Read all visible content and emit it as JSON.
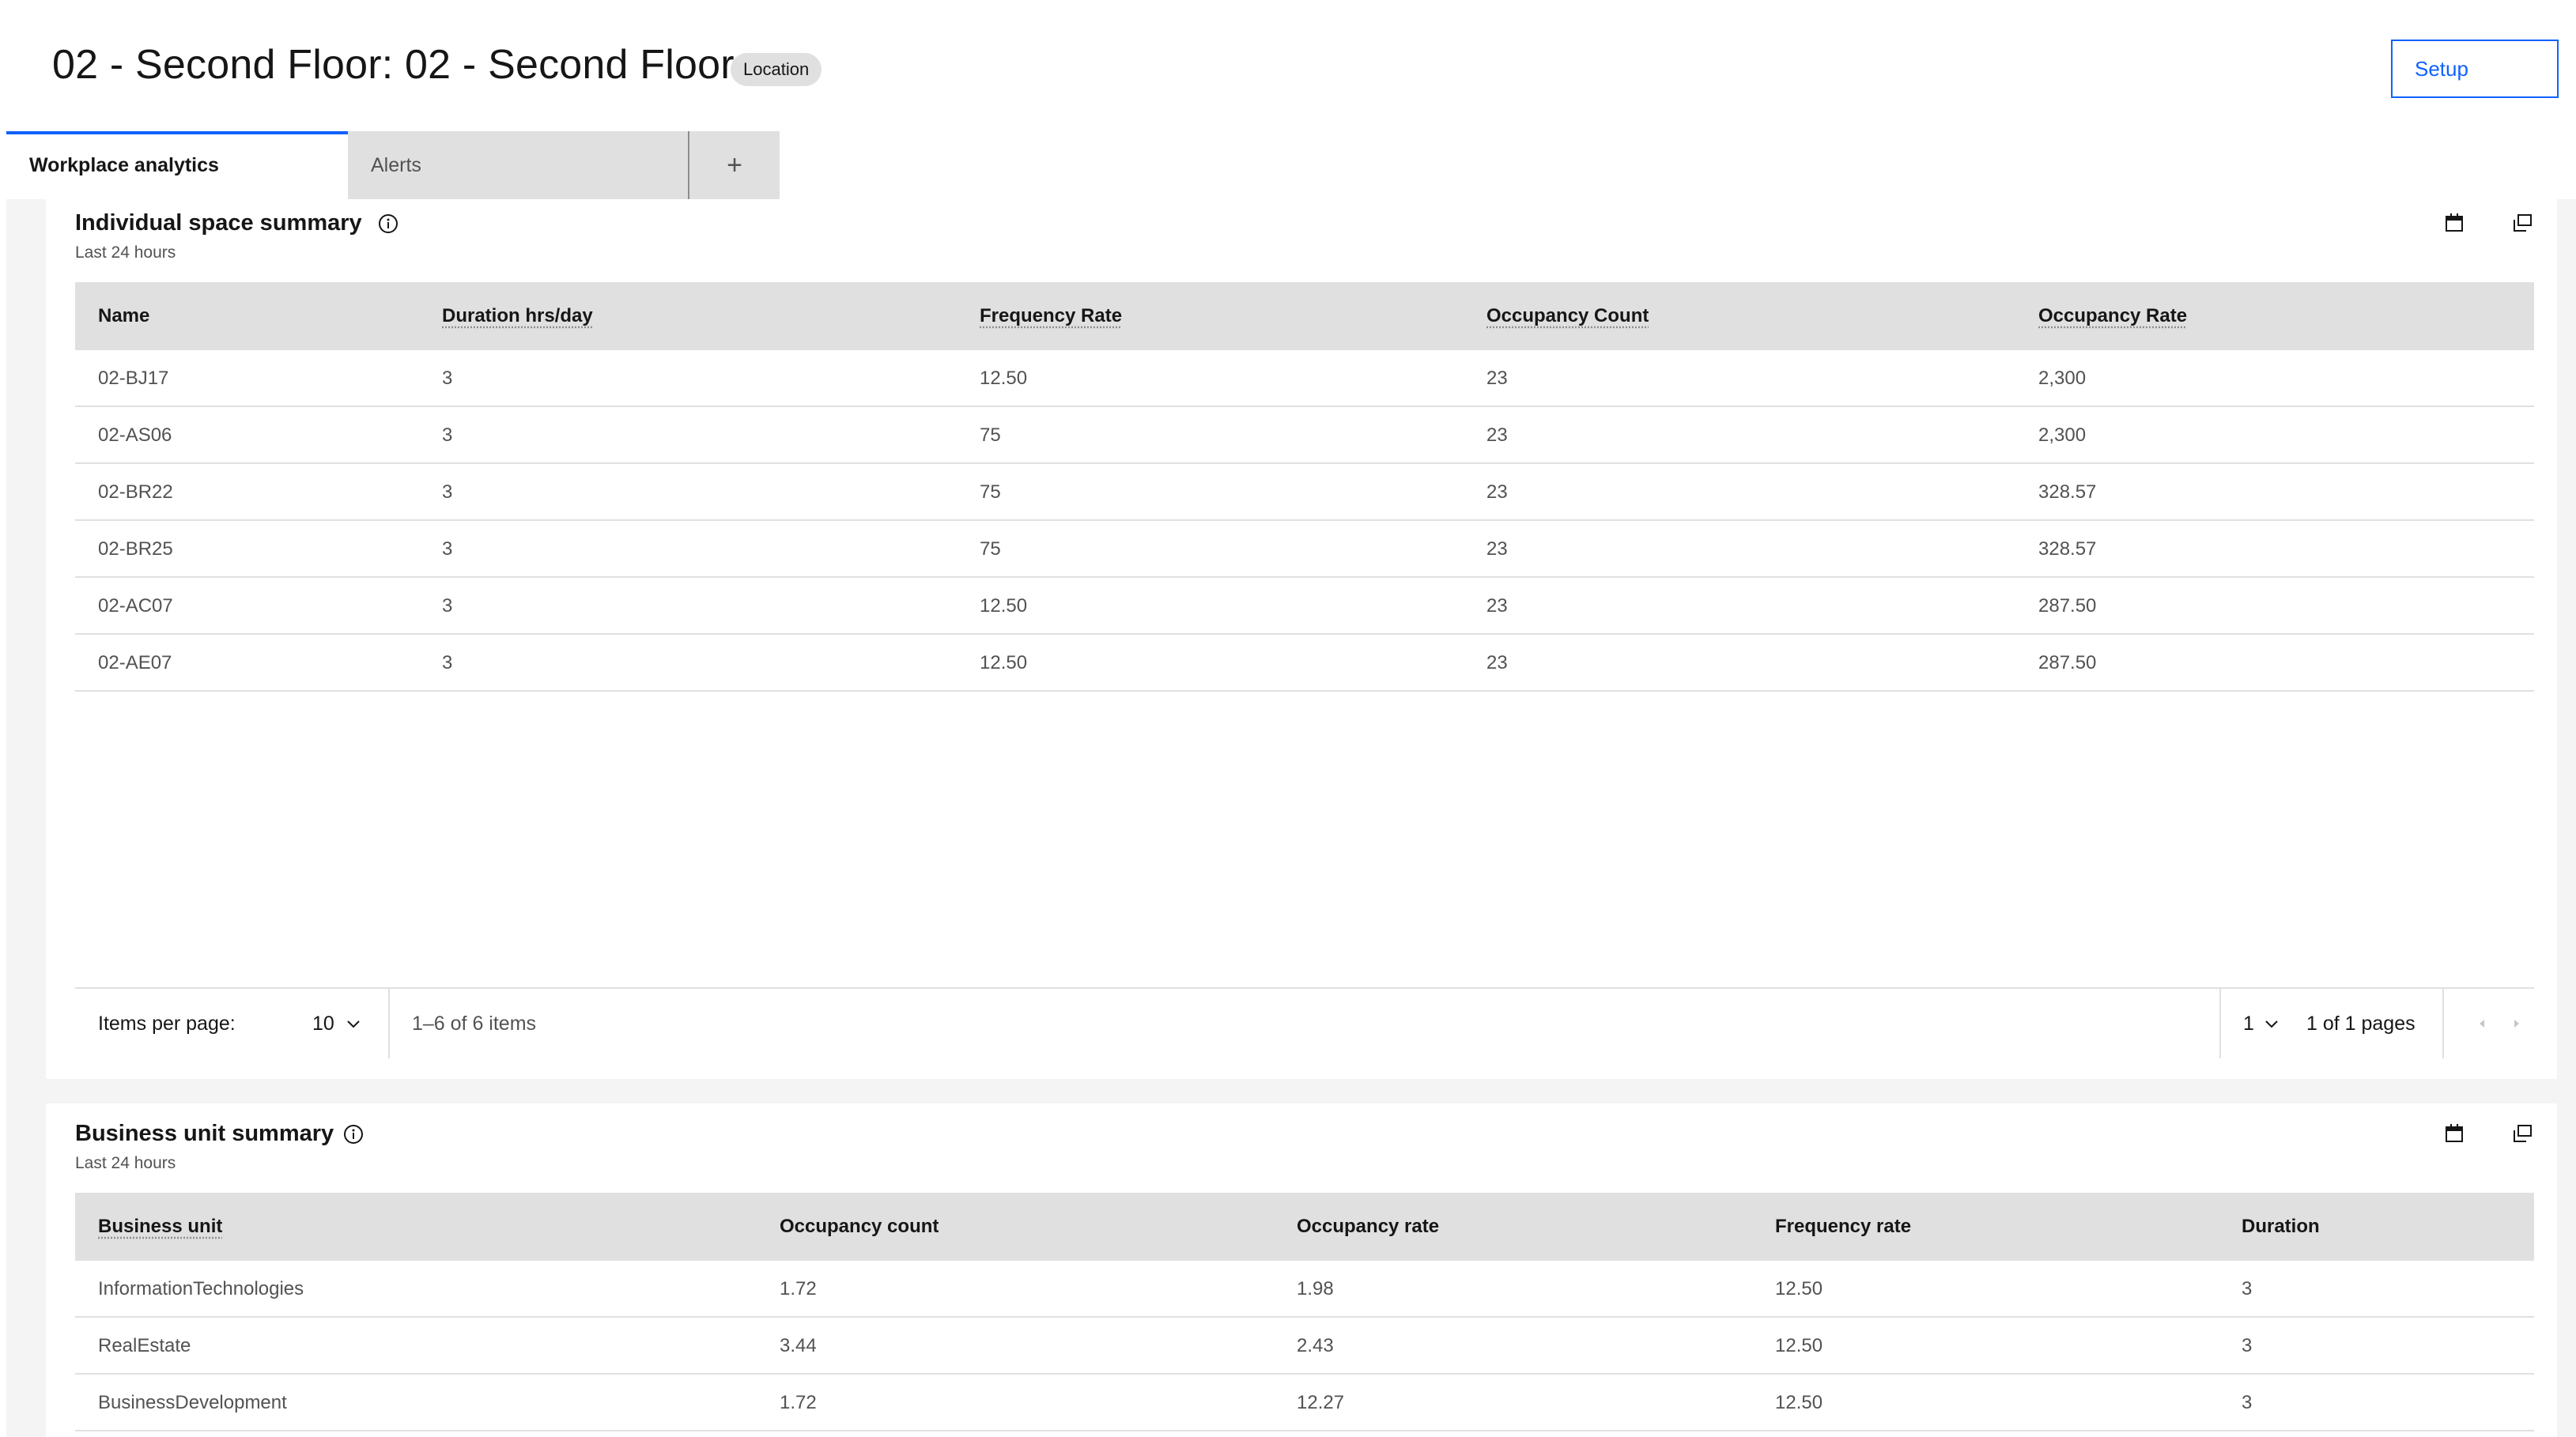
{
  "header": {
    "title": "02 - Second Floor: 02 - Second Floor",
    "tag": "Location",
    "setup_label": "Setup"
  },
  "tabs": [
    {
      "label": "Workplace analytics",
      "active": true
    },
    {
      "label": "Alerts",
      "active": false
    },
    {
      "label": "+",
      "active": false
    }
  ],
  "space_summary": {
    "title": "Individual space summary",
    "subtitle": "Last 24 hours",
    "icons": [
      "info-icon",
      "calendar-icon",
      "expand-icon"
    ],
    "columns": [
      "Name",
      "Duration hrs/day",
      "Frequency Rate",
      "Occupancy Count",
      "Occupancy Rate"
    ],
    "rows": [
      [
        "02-BJ17",
        "3",
        "12.50",
        "23",
        "2,300"
      ],
      [
        "02-AS06",
        "3",
        "75",
        "23",
        "2,300"
      ],
      [
        "02-BR22",
        "3",
        "75",
        "23",
        "328.57"
      ],
      [
        "02-BR25",
        "3",
        "75",
        "23",
        "328.57"
      ],
      [
        "02-AC07",
        "3",
        "12.50",
        "23",
        "287.50"
      ],
      [
        "02-AE07",
        "3",
        "12.50",
        "23",
        "287.50"
      ]
    ],
    "pagination": {
      "items_per_page_label": "Items per page:",
      "items_per_page": "10",
      "range": "1–6 of 6 items",
      "page": "1",
      "page_of": "1 of 1 pages"
    }
  },
  "business_summary": {
    "title": "Business unit summary",
    "subtitle": "Last 24 hours",
    "icons": [
      "info-icon",
      "calendar-icon",
      "expand-icon"
    ],
    "columns": [
      "Business unit",
      "Occupancy count",
      "Occupancy rate",
      "Frequency rate",
      "Duration"
    ],
    "rows": [
      [
        "InformationTechnologies",
        "1.72",
        "1.98",
        "12.50",
        "3"
      ],
      [
        "RealEstate",
        "3.44",
        "2.43",
        "12.50",
        "3"
      ],
      [
        "BusinessDevelopment",
        "1.72",
        "12.27",
        "12.50",
        "3"
      ]
    ]
  },
  "colors": {
    "accent": "#0f62fe",
    "header_bg": "#e0e0e0",
    "page_bg": "#f4f4f4"
  }
}
